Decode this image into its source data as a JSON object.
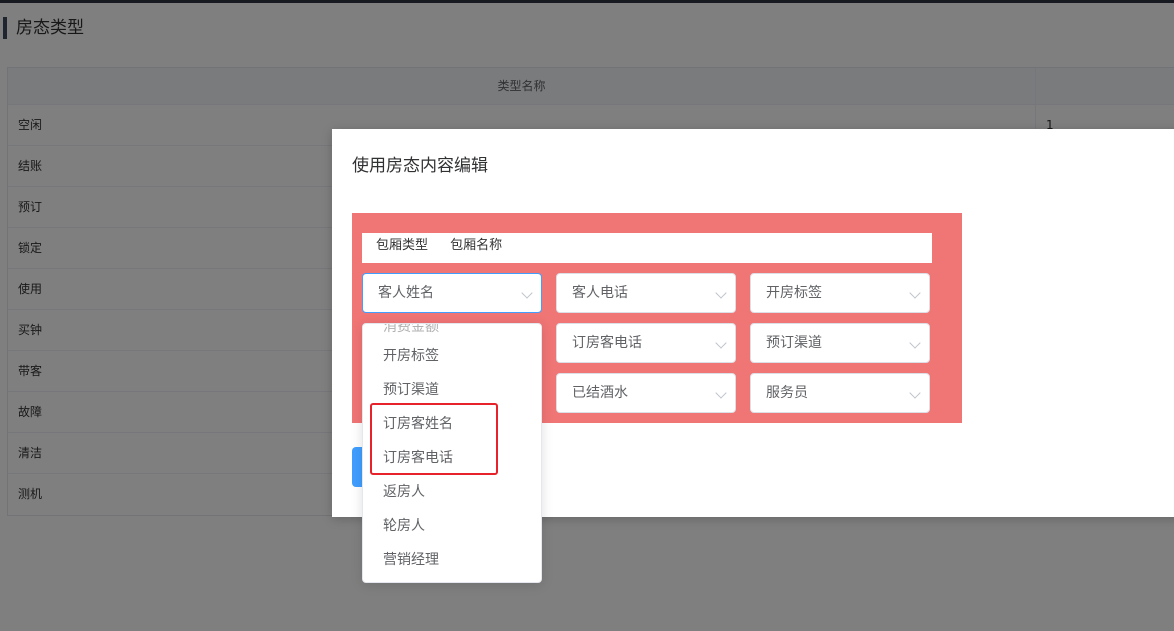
{
  "page": {
    "title": "房态类型"
  },
  "table": {
    "header": "类型名称",
    "rows": [
      {
        "name": "空闲",
        "value": "1"
      },
      {
        "name": "结账",
        "value": ""
      },
      {
        "name": "预订",
        "value": ""
      },
      {
        "name": "锁定",
        "value": ""
      },
      {
        "name": "使用",
        "value": ""
      },
      {
        "name": "买钟",
        "value": ""
      },
      {
        "name": "带客",
        "value": ""
      },
      {
        "name": "故障",
        "value": ""
      },
      {
        "name": "清洁",
        "value": ""
      },
      {
        "name": "测机",
        "value": ""
      }
    ]
  },
  "dialog": {
    "title": "使用房态内容编辑",
    "tags": [
      "包厢类型",
      "包厢名称"
    ],
    "panel_color": "#f07575",
    "selects": [
      "客人姓名",
      "客人电话",
      "开房标签",
      "订房客电话",
      "预订渠道",
      "已结酒水",
      "服务员"
    ]
  },
  "dropdown": {
    "partial_item": "消费金额",
    "items": [
      "开房标签",
      "预订渠道",
      "订房客姓名",
      "订房客电话",
      "返房人",
      "轮房人",
      "营销经理"
    ]
  },
  "colors": {
    "accent": "#409eff",
    "highlight": "#e8222a"
  }
}
